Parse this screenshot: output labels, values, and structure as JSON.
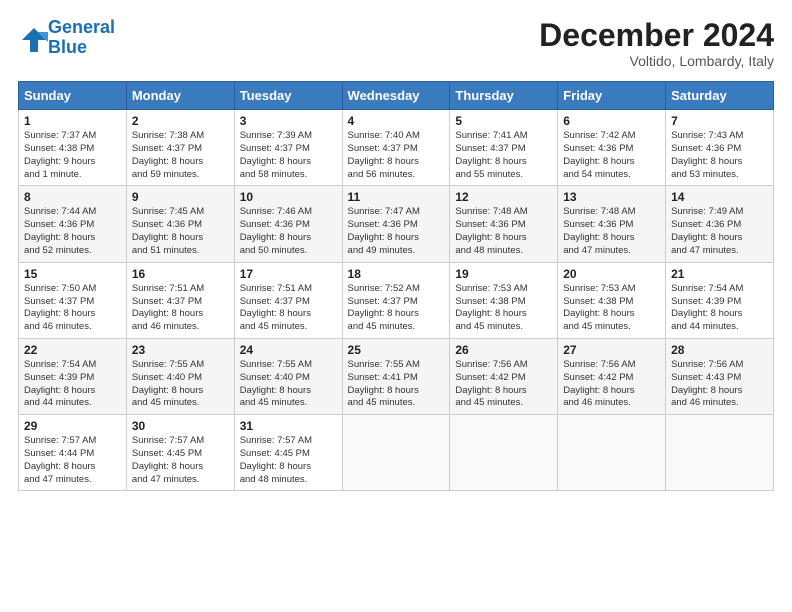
{
  "logo": {
    "line1": "General",
    "line2": "Blue"
  },
  "title": "December 2024",
  "subtitle": "Voltido, Lombardy, Italy",
  "headers": [
    "Sunday",
    "Monday",
    "Tuesday",
    "Wednesday",
    "Thursday",
    "Friday",
    "Saturday"
  ],
  "weeks": [
    [
      {
        "day": "1",
        "info": "Sunrise: 7:37 AM\nSunset: 4:38 PM\nDaylight: 9 hours\nand 1 minute."
      },
      {
        "day": "2",
        "info": "Sunrise: 7:38 AM\nSunset: 4:37 PM\nDaylight: 8 hours\nand 59 minutes."
      },
      {
        "day": "3",
        "info": "Sunrise: 7:39 AM\nSunset: 4:37 PM\nDaylight: 8 hours\nand 58 minutes."
      },
      {
        "day": "4",
        "info": "Sunrise: 7:40 AM\nSunset: 4:37 PM\nDaylight: 8 hours\nand 56 minutes."
      },
      {
        "day": "5",
        "info": "Sunrise: 7:41 AM\nSunset: 4:37 PM\nDaylight: 8 hours\nand 55 minutes."
      },
      {
        "day": "6",
        "info": "Sunrise: 7:42 AM\nSunset: 4:36 PM\nDaylight: 8 hours\nand 54 minutes."
      },
      {
        "day": "7",
        "info": "Sunrise: 7:43 AM\nSunset: 4:36 PM\nDaylight: 8 hours\nand 53 minutes."
      }
    ],
    [
      {
        "day": "8",
        "info": "Sunrise: 7:44 AM\nSunset: 4:36 PM\nDaylight: 8 hours\nand 52 minutes."
      },
      {
        "day": "9",
        "info": "Sunrise: 7:45 AM\nSunset: 4:36 PM\nDaylight: 8 hours\nand 51 minutes."
      },
      {
        "day": "10",
        "info": "Sunrise: 7:46 AM\nSunset: 4:36 PM\nDaylight: 8 hours\nand 50 minutes."
      },
      {
        "day": "11",
        "info": "Sunrise: 7:47 AM\nSunset: 4:36 PM\nDaylight: 8 hours\nand 49 minutes."
      },
      {
        "day": "12",
        "info": "Sunrise: 7:48 AM\nSunset: 4:36 PM\nDaylight: 8 hours\nand 48 minutes."
      },
      {
        "day": "13",
        "info": "Sunrise: 7:48 AM\nSunset: 4:36 PM\nDaylight: 8 hours\nand 47 minutes."
      },
      {
        "day": "14",
        "info": "Sunrise: 7:49 AM\nSunset: 4:36 PM\nDaylight: 8 hours\nand 47 minutes."
      }
    ],
    [
      {
        "day": "15",
        "info": "Sunrise: 7:50 AM\nSunset: 4:37 PM\nDaylight: 8 hours\nand 46 minutes."
      },
      {
        "day": "16",
        "info": "Sunrise: 7:51 AM\nSunset: 4:37 PM\nDaylight: 8 hours\nand 46 minutes."
      },
      {
        "day": "17",
        "info": "Sunrise: 7:51 AM\nSunset: 4:37 PM\nDaylight: 8 hours\nand 45 minutes."
      },
      {
        "day": "18",
        "info": "Sunrise: 7:52 AM\nSunset: 4:37 PM\nDaylight: 8 hours\nand 45 minutes."
      },
      {
        "day": "19",
        "info": "Sunrise: 7:53 AM\nSunset: 4:38 PM\nDaylight: 8 hours\nand 45 minutes."
      },
      {
        "day": "20",
        "info": "Sunrise: 7:53 AM\nSunset: 4:38 PM\nDaylight: 8 hours\nand 45 minutes."
      },
      {
        "day": "21",
        "info": "Sunrise: 7:54 AM\nSunset: 4:39 PM\nDaylight: 8 hours\nand 44 minutes."
      }
    ],
    [
      {
        "day": "22",
        "info": "Sunrise: 7:54 AM\nSunset: 4:39 PM\nDaylight: 8 hours\nand 44 minutes."
      },
      {
        "day": "23",
        "info": "Sunrise: 7:55 AM\nSunset: 4:40 PM\nDaylight: 8 hours\nand 45 minutes."
      },
      {
        "day": "24",
        "info": "Sunrise: 7:55 AM\nSunset: 4:40 PM\nDaylight: 8 hours\nand 45 minutes."
      },
      {
        "day": "25",
        "info": "Sunrise: 7:55 AM\nSunset: 4:41 PM\nDaylight: 8 hours\nand 45 minutes."
      },
      {
        "day": "26",
        "info": "Sunrise: 7:56 AM\nSunset: 4:42 PM\nDaylight: 8 hours\nand 45 minutes."
      },
      {
        "day": "27",
        "info": "Sunrise: 7:56 AM\nSunset: 4:42 PM\nDaylight: 8 hours\nand 46 minutes."
      },
      {
        "day": "28",
        "info": "Sunrise: 7:56 AM\nSunset: 4:43 PM\nDaylight: 8 hours\nand 46 minutes."
      }
    ],
    [
      {
        "day": "29",
        "info": "Sunrise: 7:57 AM\nSunset: 4:44 PM\nDaylight: 8 hours\nand 47 minutes."
      },
      {
        "day": "30",
        "info": "Sunrise: 7:57 AM\nSunset: 4:45 PM\nDaylight: 8 hours\nand 47 minutes."
      },
      {
        "day": "31",
        "info": "Sunrise: 7:57 AM\nSunset: 4:45 PM\nDaylight: 8 hours\nand 48 minutes."
      },
      {
        "day": "",
        "info": ""
      },
      {
        "day": "",
        "info": ""
      },
      {
        "day": "",
        "info": ""
      },
      {
        "day": "",
        "info": ""
      }
    ]
  ]
}
